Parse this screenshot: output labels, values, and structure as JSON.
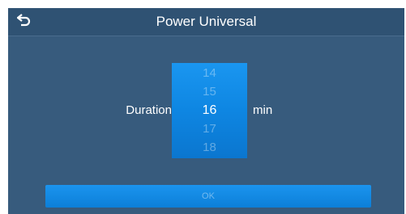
{
  "header": {
    "back_icon": "back-arrow-icon",
    "title": "Power Universal"
  },
  "setting": {
    "label": "Duration",
    "unit": "min",
    "picker": {
      "options": [
        "14",
        "15",
        "16",
        "17",
        "18"
      ],
      "selected": "16"
    }
  },
  "footer": {
    "ok_label": "OK"
  },
  "colors": {
    "background": "#375b7d",
    "header": "#2f5273",
    "accent": "#0e86e2",
    "text": "#ffffff"
  }
}
